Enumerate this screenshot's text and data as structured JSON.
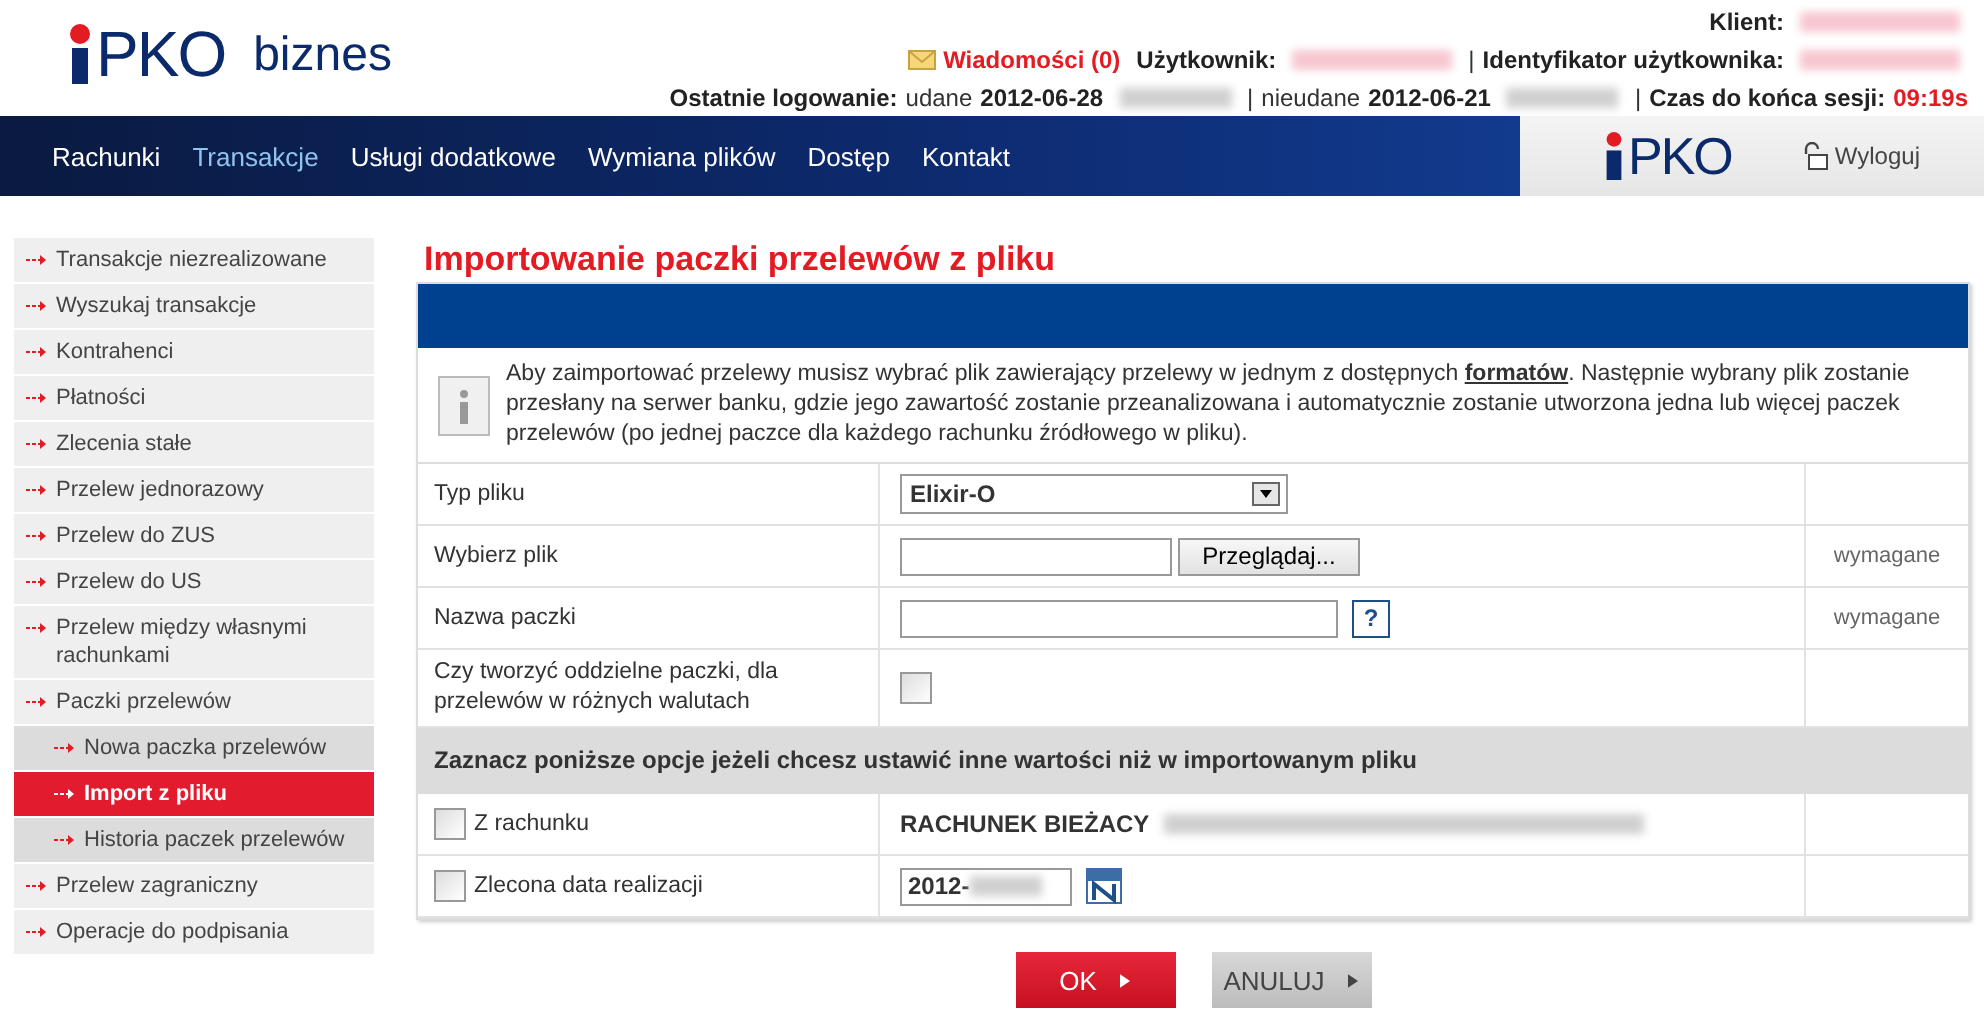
{
  "header": {
    "logo": "PKO",
    "logo_word": "biznes",
    "lines": [
      [
        {
          "kind": "label",
          "text": "Klient:"
        },
        {
          "kind": "redacted"
        }
      ],
      [
        {
          "kind": "messages",
          "text": "Wiadomości (0)"
        },
        {
          "kind": "label",
          "text": "Użytkownik:"
        },
        {
          "kind": "redacted"
        },
        {
          "kind": "sep",
          "text": "|"
        },
        {
          "kind": "label",
          "text": "Identyfikator użytkownika:"
        },
        {
          "kind": "redacted"
        }
      ],
      [
        {
          "kind": "label",
          "text": "Ostatnie logowanie:"
        },
        {
          "kind": "text",
          "text": "udane"
        },
        {
          "kind": "label",
          "text": "2012-06-28"
        },
        {
          "kind": "redacted"
        },
        {
          "kind": "sep",
          "text": "|"
        },
        {
          "kind": "text",
          "text": "nieudane"
        },
        {
          "kind": "label",
          "text": "2012-06-21"
        },
        {
          "kind": "redacted"
        },
        {
          "kind": "sep",
          "text": "|"
        },
        {
          "kind": "label",
          "text": "Czas do końca sesji:"
        },
        {
          "kind": "alert",
          "text": "09:19s"
        }
      ]
    ]
  },
  "nav": {
    "items": [
      {
        "label": "Rachunki",
        "selected": false
      },
      {
        "label": "Transakcje",
        "selected": true
      },
      {
        "label": "Usługi dodatkowe",
        "selected": false
      },
      {
        "label": "Wymiana plików",
        "selected": false
      },
      {
        "label": "Dostęp",
        "selected": false
      },
      {
        "label": "Kontakt",
        "selected": false
      }
    ],
    "logo": "PKO",
    "logout": "Wyloguj"
  },
  "sidebar": {
    "items": [
      {
        "label": "Transakcje niezrealizowane",
        "selected": false
      },
      {
        "label": "Wyszukaj transakcje",
        "selected": false
      },
      {
        "label": "Kontrahenci",
        "selected": false
      },
      {
        "label": "Płatności",
        "selected": false
      },
      {
        "label": "Zlecenia stałe",
        "selected": false
      },
      {
        "label": "Przelew jednorazowy",
        "selected": false
      },
      {
        "label": "Przelew do ZUS",
        "selected": false
      },
      {
        "label": "Przelew do US",
        "selected": false
      },
      {
        "label": "Przelew między własnymi rachunkami",
        "selected": false
      },
      {
        "label": "Paczki przelewów",
        "selected": false,
        "children": [
          {
            "label": "Nowa paczka przelewów",
            "selected": false
          },
          {
            "label": "Import z pliku",
            "selected": true
          },
          {
            "label": "Historia paczek przelewów",
            "selected": false
          }
        ]
      },
      {
        "label": "Przelew zagraniczny",
        "selected": false
      },
      {
        "label": "Operacje do podpisania",
        "selected": false
      }
    ]
  },
  "page": {
    "title": "Importowanie paczki przelewów z pliku",
    "info": {
      "before": "Aby zaimportować przelewy musisz wybrać plik zawierający przelewy w jednym z dostępnych",
      "link": "formatów",
      "after": ". Następnie wybrany plik zostanie przesłany na serwer banku, gdzie jego zawartość zostanie przeanalizowana i automatycznie zostanie utworzona jedna lub więcej paczek przelewów (po jednej paczce dla każdego rachunku źródłowego w pliku)."
    },
    "rows": [
      {
        "kind": "select",
        "label": "Typ pliku",
        "value": "Elixir-O"
      },
      {
        "kind": "file",
        "label": "Wybierz plik",
        "button": "Przeglądaj...",
        "note": "wymagane"
      },
      {
        "kind": "text",
        "label": "Nazwa paczki",
        "help": "?",
        "note": "wymagane"
      },
      {
        "kind": "checkbox",
        "label": "Czy tworzyć oddzielne paczki, dla przelewów w różnych walutach",
        "checked": false
      }
    ],
    "section": "Zaznacz poniższe opcje jeżeli chcesz ustawić inne wartości niż w importowanym pliku",
    "overrides": [
      {
        "kind": "account",
        "label": "Z rachunku",
        "checked": false,
        "value": "RACHUNEK BIEŻACY"
      },
      {
        "kind": "date",
        "label": "Zlecona data realizacji",
        "checked": false,
        "value": "2012-"
      }
    ],
    "buttons": [
      {
        "kind": "primary",
        "label": "OK"
      },
      {
        "kind": "secondary",
        "label": "ANULUJ"
      }
    ]
  }
}
